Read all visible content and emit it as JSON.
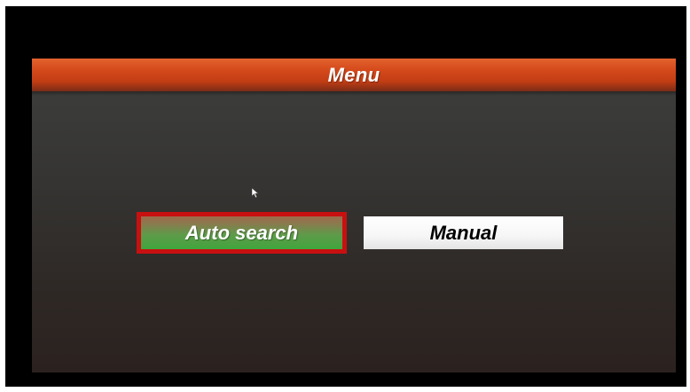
{
  "menu": {
    "title": "Menu",
    "options": [
      {
        "label": "Auto search",
        "selected": true
      },
      {
        "label": "Manual",
        "selected": false
      }
    ]
  },
  "colors": {
    "titlebar": "#d54a1c",
    "selected_border": "#c81010",
    "selected_fill": "#3fa53d",
    "unselected_fill": "#f6f6f6"
  },
  "icons": [
    "pointer-cursor-icon"
  ]
}
